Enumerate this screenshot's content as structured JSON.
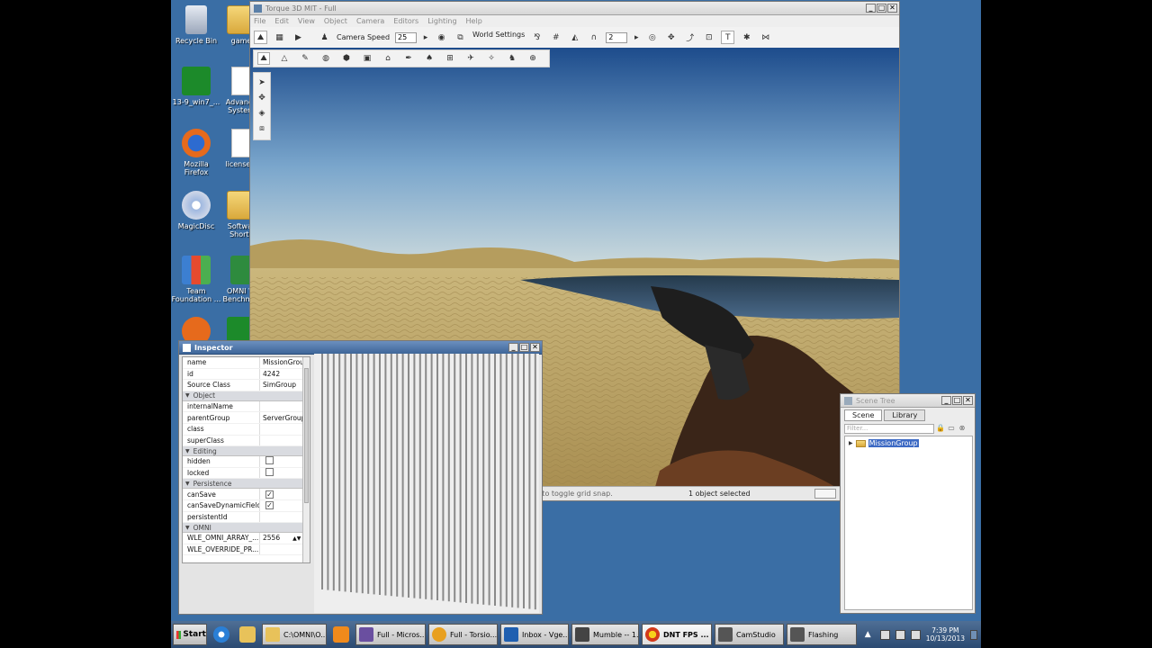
{
  "desktop": {
    "icons": [
      {
        "label": "Recycle Bin",
        "icon": "recycle-bin-icon",
        "color": "#c0c8d8"
      },
      {
        "label": "game",
        "icon": "folder-icon",
        "color": "#e8c25a"
      },
      {
        "label": "13-9_win7_...",
        "icon": "amd-icon",
        "color": "#1c8a2a"
      },
      {
        "label": "Advance System",
        "icon": "document-icon",
        "color": "#ffffff"
      },
      {
        "label": "Mozilla Firefox",
        "icon": "firefox-icon",
        "color": "#e66a1c"
      },
      {
        "label": "license.v",
        "icon": "document-icon",
        "color": "#ffffff"
      },
      {
        "label": "MagicDisc",
        "icon": "magicdisc-icon",
        "color": "#9fb8e0"
      },
      {
        "label": "Softwar Shortc",
        "icon": "folder-icon",
        "color": "#e8c25a"
      },
      {
        "label": "Team Foundation ...",
        "icon": "team-foundation-icon",
        "color": "#3c7fd1"
      },
      {
        "label": "OMNI W Benchmar",
        "icon": "excel-icon",
        "color": "#2e8b3e"
      }
    ]
  },
  "torque": {
    "title": "Torque 3D MIT - Full",
    "menu": [
      "File",
      "Edit",
      "View",
      "Object",
      "Camera",
      "Editors",
      "Lighting",
      "Help"
    ],
    "camera_speed_label": "Camera Speed",
    "camera_speed_value": "25",
    "world_settings_label": "World Settings",
    "grid_value": "2",
    "status_hint": "ALT-drag to duplicate objects. CTRL to toggle snapping. ALT to toggle grid snap.",
    "status_selected": "1 object selected"
  },
  "inspector": {
    "title": "Inspector",
    "rows_top": [
      {
        "name": "name",
        "value": "MissionGroup"
      },
      {
        "name": "id",
        "value": "4242"
      },
      {
        "name": "Source Class",
        "value": "SimGroup"
      }
    ],
    "group_object": "Object",
    "rows_object": [
      {
        "name": "internalName",
        "value": ""
      },
      {
        "name": "parentGroup",
        "value": "ServerGroup"
      },
      {
        "name": "class",
        "value": ""
      },
      {
        "name": "superClass",
        "value": ""
      }
    ],
    "group_editing": "Editing",
    "rows_editing": [
      {
        "name": "hidden",
        "checked": false
      },
      {
        "name": "locked",
        "checked": false
      }
    ],
    "group_persistence": "Persistence",
    "rows_persistence": [
      {
        "name": "canSave",
        "checked": true
      },
      {
        "name": "canSaveDynamicFields",
        "checked": true
      },
      {
        "name": "persistentId",
        "value": ""
      }
    ],
    "group_omni": "OMNI",
    "rows_omni": [
      {
        "name": "WLE_OMNI_ARRAY_...",
        "value": "2556"
      },
      {
        "name": "WLE_OVERRIDE_PR...",
        "value": ""
      }
    ]
  },
  "scene_tree": {
    "title": "Scene Tree",
    "tab_scene": "Scene",
    "tab_library": "Library",
    "filter_placeholder": "Filter...",
    "root_item": "MissionGroup"
  },
  "taskbar": {
    "start": "Start",
    "tasks": [
      {
        "label": "C:\\OMNI\\O...",
        "icon": "folder-icon",
        "color": "#e8c25a"
      },
      {
        "label": "Full - Micros...",
        "icon": "visual-studio-icon",
        "color": "#6a4fa0"
      },
      {
        "label": "Full - Torsio...",
        "icon": "torsion-icon",
        "color": "#e8a020"
      },
      {
        "label": "Inbox - Vge...",
        "icon": "outlook-icon",
        "color": "#1f5fb0"
      },
      {
        "label": "Mumble -- 1...",
        "icon": "mumble-icon",
        "color": "#444444"
      },
      {
        "label": "DNT FPS ...",
        "icon": "dnt-icon",
        "color": "#d33a1a"
      },
      {
        "label": "CamStudio",
        "icon": "camstudio-icon",
        "color": "#555555"
      },
      {
        "label": "Flashing",
        "icon": "window-icon",
        "color": "#555555"
      }
    ],
    "clock_time": "7:39 PM",
    "clock_date": "10/13/2013"
  }
}
